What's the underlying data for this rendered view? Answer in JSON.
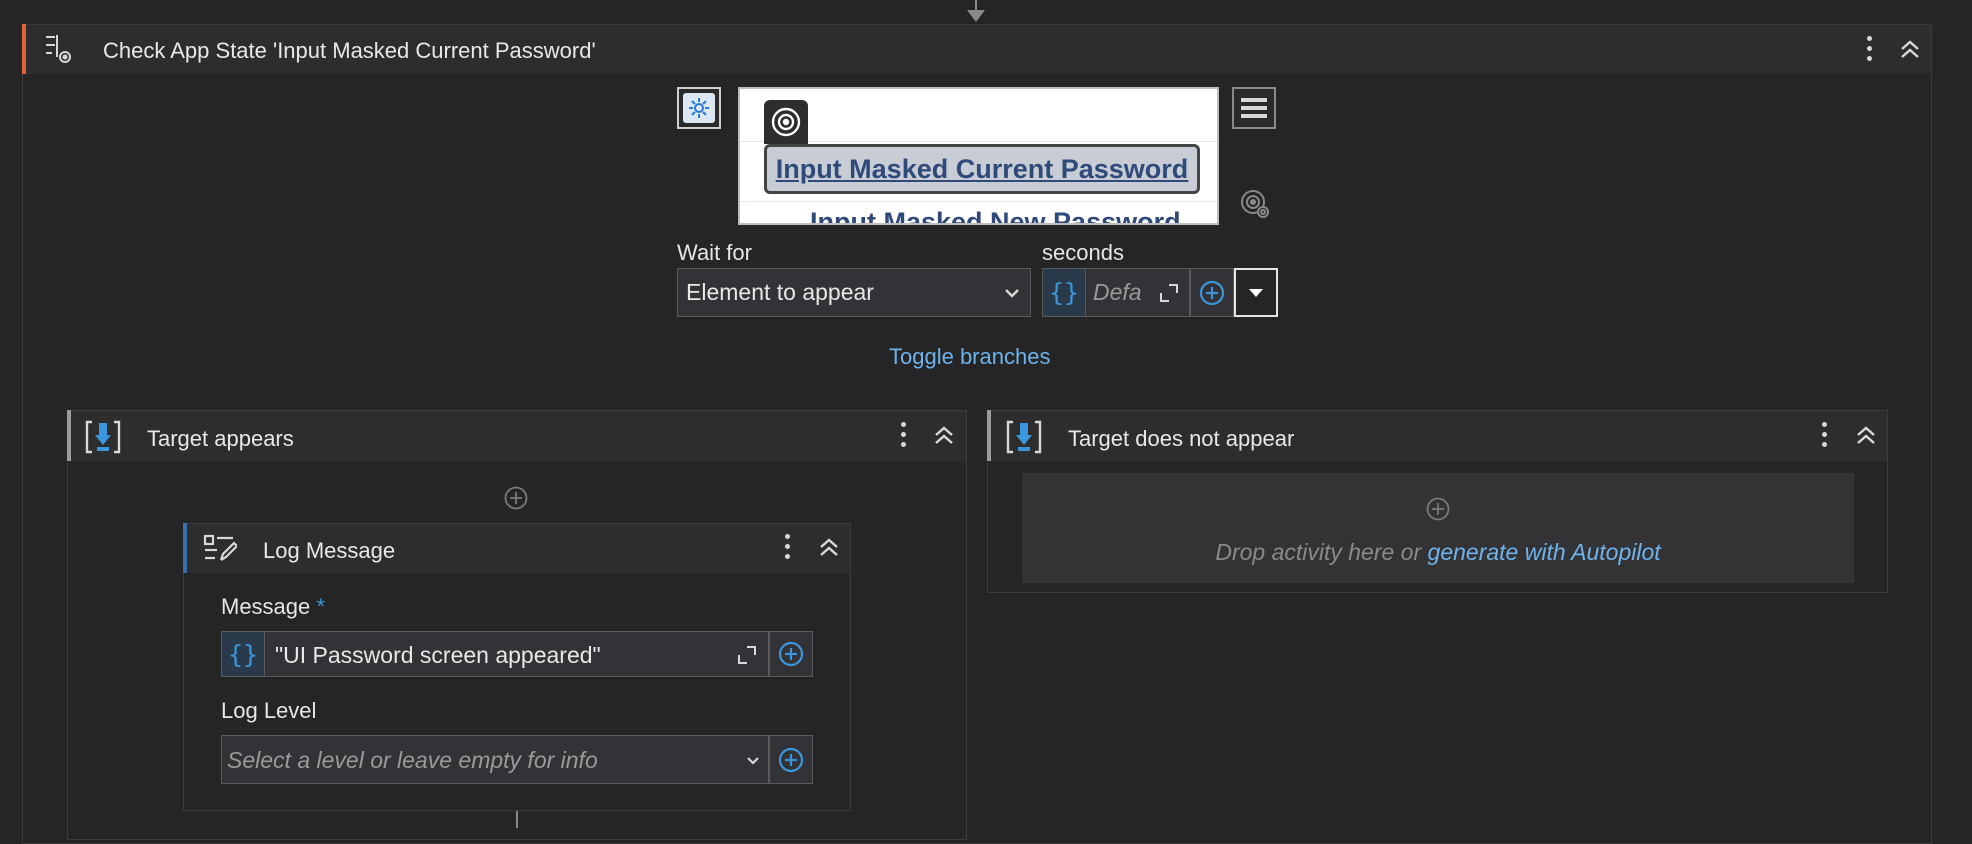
{
  "outer_activity": {
    "title": "Check App State 'Input Masked Current Password'",
    "icon": "check-app-state-icon",
    "accent_color": "#e0623a"
  },
  "target_screenshot": {
    "highlighted_text": "Input Masked Current Password",
    "partial_text_below": "Input Masked New Password"
  },
  "wait_for": {
    "label": "Wait for",
    "value": "Element to appear"
  },
  "seconds": {
    "label": "seconds",
    "placeholder": "Defa"
  },
  "toggle_branches": "Toggle branches",
  "branch_appears": {
    "title": "Target appears"
  },
  "log_message": {
    "title": "Log Message",
    "message_label": "Message",
    "required_mark": "*",
    "message_value": "\"UI Password screen appeared\"",
    "log_level_label": "Log Level",
    "log_level_placeholder": "Select a level or leave empty for info"
  },
  "branch_not_appears": {
    "title": "Target does not appear",
    "drop_text": "Drop activity here or ",
    "autopilot_link": "generate with Autopilot"
  },
  "colors": {
    "background": "#252526",
    "header": "#2d2d2e",
    "accent_blue": "#3a96dd",
    "link": "#6fb3ec"
  }
}
